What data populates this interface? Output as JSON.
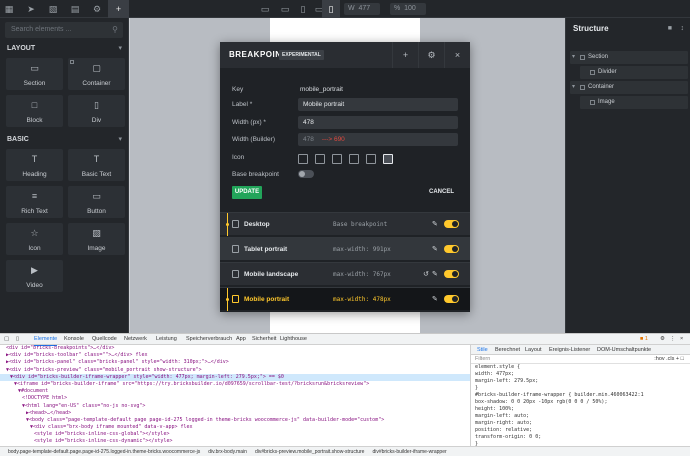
{
  "topbar": {
    "width_label": "W",
    "width_value": "477",
    "zoom_label": "%",
    "zoom_value": "100"
  },
  "left_panel": {
    "search_placeholder": "Search elements ...",
    "categories": [
      {
        "label": "LAYOUT",
        "items": [
          {
            "label": "Section",
            "icon": "section-icon"
          },
          {
            "label": "Container",
            "icon": "container-icon"
          },
          {
            "label": "Block",
            "icon": "block-icon"
          },
          {
            "label": "Div",
            "icon": "div-icon"
          }
        ]
      },
      {
        "label": "BASIC",
        "items": [
          {
            "label": "Heading",
            "icon": "heading-icon"
          },
          {
            "label": "Basic Text",
            "icon": "text-icon"
          },
          {
            "label": "Rich Text",
            "icon": "rich-text-icon"
          },
          {
            "label": "Button",
            "icon": "button-icon"
          },
          {
            "label": "Icon",
            "icon": "star-icon"
          },
          {
            "label": "Image",
            "icon": "image-icon"
          },
          {
            "label": "Video",
            "icon": "video-icon"
          }
        ]
      }
    ]
  },
  "modal": {
    "title": "BREAKPOINTS",
    "badge": "EXPERIMENTAL",
    "key_label": "Key",
    "key_value": "mobile_portrait",
    "label_label": "Label *",
    "label_value": "Mobile portrait",
    "width_label": "Width (px) *",
    "width_value": "478",
    "builder_label": "Width (Builder)",
    "builder_value": "478",
    "builder_note": "---> 690",
    "icon_label": "Icon",
    "base_label": "Base breakpoint",
    "update_label": "UPDATE",
    "cancel_label": "CANCEL",
    "breakpoints": [
      {
        "name": "Desktop",
        "query": "Base breakpoint"
      },
      {
        "name": "Tablet portrait",
        "query": "max-width: 991px"
      },
      {
        "name": "Mobile landscape",
        "query": "max-width: 767px"
      },
      {
        "name": "Mobile portrait",
        "query": "max-width: 478px"
      }
    ]
  },
  "right_panel": {
    "title": "Structure",
    "tree": [
      {
        "label": "Section"
      },
      {
        "label": "Divider"
      },
      {
        "label": "Container"
      },
      {
        "label": "Image"
      }
    ]
  },
  "devtools": {
    "tabs": [
      "Elemente",
      "Konsole",
      "Quellcode",
      "Netzwerk",
      "Leistung",
      "Speicherverbrauch",
      "App",
      "Sicherheit",
      "Lighthouse"
    ],
    "issues_count": "1",
    "dom_lines": [
      "<div id=\"bricks-breakpoints\">…</div>",
      "▶<div id=\"bricks-toolbar\" class=\"\">…</div> flex",
      "▶<div id=\"bricks-panel\" class=\"bricks-panel\" style=\"width: 310px;\">…</div>",
      "▼<div id=\"bricks-preview\" class=\"mobile_portrait show-structure\">",
      "▼<div id=\"bricks-builder-iframe-wrapper\" style=\"width: 477px; margin-left: 279.5px;\"> == $0",
      "▼<iframe id=\"bricks-builder-iframe\" src=\"https://try.bricksbuilder.io/d097659/scrollbar-test/?bricksrun&bricksreview\">",
      "▼#document",
      "<!DOCTYPE html>",
      "▼<html lang=\"en-US\" class=\"no-js no-svg\">",
      "▶<head>…</head>",
      "▼<body class=\"page-template-default page page-id-275 logged-in theme-bricks woocommerce-js\" data-builder-mode=\"custom\">",
      "▼<div class=\"brx-body iframe mounted\" data-v-app> flex",
      "<style id=\"bricks-inline-css-global\"></style>",
      "<style id=\"bricks-inline-css-dynamic\"></style>",
      "<style id=\"bricks-inline-css-themestyles\"></style>"
    ],
    "styles_tabs": [
      "Stile",
      "Berechnet",
      "Layout",
      "Ereignis-Listener",
      "DOM-Umschaltpunkte"
    ],
    "filter_placeholder": "Filtern",
    "filter_tools": ":hov .cls + □",
    "style_lines": [
      "element.style {",
      "  width: 477px;",
      "  margin-left: 279.5px;",
      "}",
      "#bricks-builder-iframe-wrapper {        builder.min.460063422:1",
      "  box-shadow: 0 0 20px -10px rgb(0 0 0 / 50%);",
      "  height: 100%;",
      "  margin-left: auto;",
      "  margin-right: auto;",
      "  position: relative;",
      "  transform-origin: 0 0;",
      "}",
      "* {                                       frontend.mi.670211549:1",
      "  border-color: var(--bricks-border-color);"
    ],
    "breadcrumb": [
      "body.page-template-default.page.page-id-275.logged-in.theme-bricks.woocommerce-js",
      "div.brx-body.main",
      "div#bricks-preview.mobile_portrait.show-structure",
      "div#bricks-builder-iframe-wrapper"
    ]
  }
}
